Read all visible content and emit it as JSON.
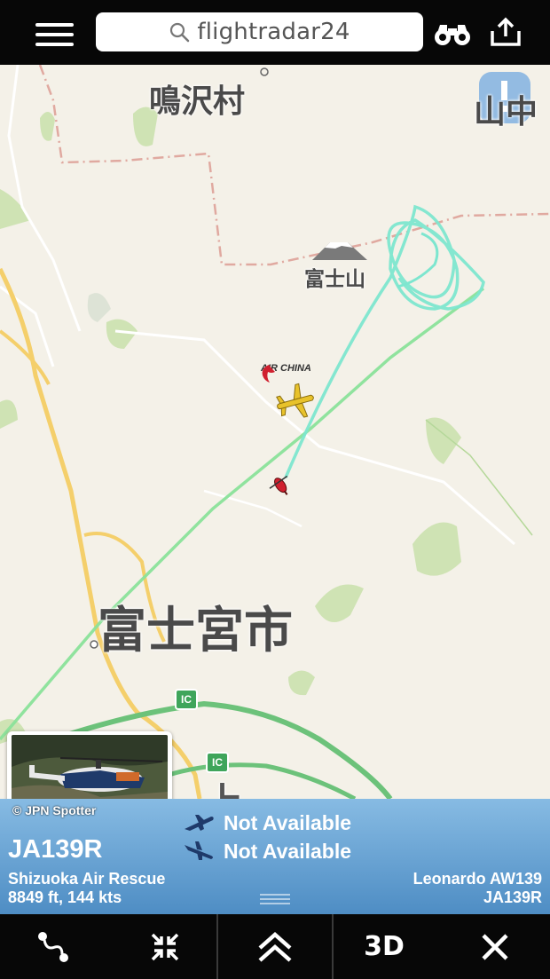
{
  "header": {
    "search_text": "flightradar24",
    "icons": [
      "menu-icon",
      "search-icon",
      "binoculars-icon",
      "share-icon"
    ]
  },
  "map": {
    "labels": {
      "narusawa": "鳴沢村",
      "yamanaka": "山中",
      "fujisan": "富士山",
      "fujinomiya": "富士宮市",
      "airline_logo_text": "AIR CHINA",
      "ic1": "IC",
      "ic2": "IC",
      "bottom_partial": "上"
    },
    "colors": {
      "track": "#7de6cf",
      "track_green": "#8ae29a",
      "land": "#f4f1e8",
      "park": "#cfe3b4",
      "road": "#f4cf6b",
      "highway": "#6cc27a"
    }
  },
  "photo": {
    "credit": "© JPN Spotter"
  },
  "panel": {
    "departure": "Not Available",
    "arrival": "Not Available",
    "registration": "JA139R",
    "airline": "Shizuoka Air Rescue",
    "altitude_speed": "8849 ft, 144 kts",
    "aircraft_type": "Leonardo AW139",
    "registration_small": "JA139R"
  },
  "toolbar": {
    "route_icon": "route-icon",
    "collapse_icon": "collapse-icon",
    "expand_icon": "chevron-up-double-icon",
    "mode_3d": "3D",
    "close_icon": "close-icon"
  }
}
